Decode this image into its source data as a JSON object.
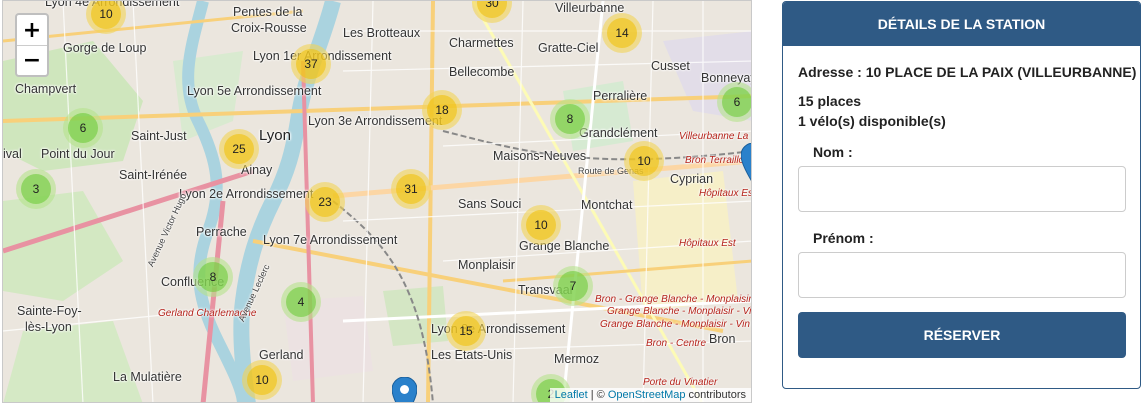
{
  "map": {
    "zoom_in": "+",
    "zoom_out": "−",
    "attribution": {
      "leaflet": "Leaflet",
      "separator": " | © ",
      "osm": "OpenStreetMap",
      "suffix": " contributors"
    },
    "labels": [
      "Lyon 4e Arrondissement",
      "Pentes de la",
      "Croix-Rousse",
      "Villeurbanne",
      "Gorge de Loup",
      "Les Brotteaux",
      "Charmettes",
      "Gratte-Ciel",
      "Lyon 1er Arrondissement",
      "Bellecombe",
      "Cusset",
      "Bonneyay",
      "Champvert",
      "Lyon 5e Arrondissement",
      "Perralière",
      "Lyon",
      "Lyon 3e Arrondissement",
      "Saint-Just",
      "Grandclément",
      "Point du Jour",
      "Maisons-Neuves",
      "Ainay",
      "Saint-Irénée",
      "Cyprian",
      "Lyon 2e Arrondissement",
      "Sans Souci",
      "Montchat",
      "Perrache",
      "Lyon 7e Arrondissement",
      "Grange Blanche",
      "Monplaisir",
      "Confluence",
      "Transvaal",
      "Sainte-Foy-",
      "lès-Lyon",
      "Lyon 8e Arrondissement",
      "Gerland",
      "Les Etats-Unis",
      "Mermoz",
      "Bron",
      "La Mulatière",
      "ival"
    ],
    "red_labels": [
      "Villeurbanne La S",
      "Bron Terraillo",
      "Hôpitaux Est",
      "Hôpitaux Est",
      "Gerland Charlemagne",
      "Bron - Grange Blanche - Monplaisir",
      "Grange Blanche - Monplaisir - Vin",
      "Grange Blanche - Monplaisir - Vin",
      "Bron - Centre",
      "Porte du Vinatier"
    ],
    "road_labels": [
      "Route de Genas",
      "Avenue Victor Hugo",
      "Avenue Leclerc"
    ],
    "clusters": [
      {
        "count": "10",
        "size": "medium"
      },
      {
        "count": "14",
        "size": "medium"
      },
      {
        "count": "37",
        "size": "medium"
      },
      {
        "count": "18",
        "size": "medium"
      },
      {
        "count": "6",
        "size": "small"
      },
      {
        "count": "6",
        "size": "small"
      },
      {
        "count": "8",
        "size": "small"
      },
      {
        "count": "25",
        "size": "medium"
      },
      {
        "count": "10",
        "size": "medium"
      },
      {
        "count": "3",
        "size": "small"
      },
      {
        "count": "31",
        "size": "medium"
      },
      {
        "count": "23",
        "size": "medium"
      },
      {
        "count": "10",
        "size": "medium"
      },
      {
        "count": "8",
        "size": "small"
      },
      {
        "count": "7",
        "size": "small"
      },
      {
        "count": "4",
        "size": "small"
      },
      {
        "count": "15",
        "size": "medium"
      },
      {
        "count": "10",
        "size": "medium"
      },
      {
        "count": "2",
        "size": "small"
      },
      {
        "count": "30",
        "size": "medium"
      }
    ]
  },
  "panel": {
    "title": "DÉTAILS DE LA STATION",
    "address": "Adresse : 10 PLACE DE LA PAIX (VILLEURBANNE)",
    "places": "15 places",
    "bikes": "1 vélo(s) disponible(s)",
    "nom_label": "Nom :",
    "prenom_label": "Prénom :",
    "nom_value": "",
    "prenom_value": "",
    "reserve_button": "RÉSERVER"
  },
  "colors": {
    "header": "#2f5a85",
    "cluster_small": "#6ecc39",
    "cluster_medium": "#f0c20c",
    "marker": "#2a81cb"
  }
}
